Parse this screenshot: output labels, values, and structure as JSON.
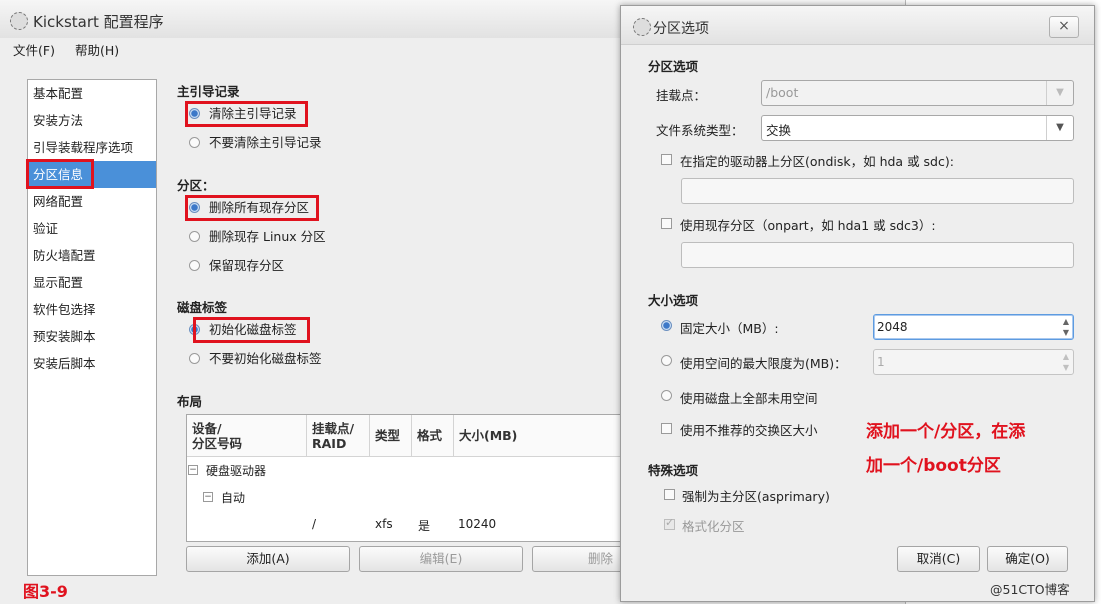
{
  "main": {
    "title": "Kickstart 配置程序",
    "menu": [
      "文件(F)",
      "帮助(H)"
    ],
    "sidebar": {
      "items": [
        "基本配置",
        "安装方法",
        "引导装载程序选项",
        "分区信息",
        "网络配置",
        "验证",
        "防火墙配置",
        "显示配置",
        "软件包选择",
        "预安装脚本",
        "安装后脚本"
      ],
      "selected": "分区信息"
    },
    "mbr": {
      "title": "主引导记录",
      "options": [
        "清除主引导记录",
        "不要清除主引导记录"
      ],
      "selected": "清除主引导记录"
    },
    "partitions": {
      "title": "分区：",
      "options": [
        "删除所有现存分区",
        "删除现存 Linux 分区",
        "保留现存分区"
      ],
      "selected": "删除所有现存分区"
    },
    "disklabel": {
      "title": "磁盘标签",
      "options": [
        "初始化磁盘标签",
        "不要初始化磁盘标签"
      ],
      "selected": "初始化磁盘标签"
    },
    "layout": {
      "title": "布局",
      "columns": [
        "设备/\n分区号码",
        "挂载点/\nRAID",
        "类型",
        "格式",
        "大小(MB)"
      ],
      "tree": {
        "root": "硬盘驱动器",
        "child": "自动",
        "row": {
          "mount": "/",
          "type": "xfs",
          "format": "是",
          "size": "10240"
        }
      }
    },
    "buttons": {
      "add": "添加(A)",
      "edit": "编辑(E)",
      "delete": "删除"
    },
    "figure_label": "图3-9"
  },
  "dialog": {
    "title": "分区选项",
    "close_icon": "×",
    "section_partition": "分区选项",
    "mount_label": "挂载点：",
    "mount_value": "/boot",
    "fs_label": "文件系统类型：",
    "fs_value": "交换",
    "ondisk_label": "在指定的驱动器上分区(ondisk，如 hda 或 sdc):",
    "onpart_label": "使用现存分区（onpart，如 hda1 或 sdc3）:",
    "section_size": "大小选项",
    "fixed_label": "固定大小（MB）:",
    "fixed_value": "2048",
    "max_label": "使用空间的最大限度为(MB)：",
    "max_value": "1",
    "fill_label": "使用磁盘上全部未用空间",
    "recommended_label": "使用不推荐的交换区大小",
    "size_selected": "固定大小（MB）:",
    "section_special": "特殊选项",
    "primary_label": "强制为主分区(asprimary)",
    "format_label": "格式化分区",
    "format_checked": true,
    "cancel": "取消(C)",
    "ok": "确定(O)"
  },
  "annotation": {
    "line1": "添加一个/分区，在添",
    "line2": "加一个/boot分区"
  },
  "watermark": "@51CTO博客",
  "colors": {
    "highlight_red": "#e0121e",
    "selection_blue": "#4a90d9"
  }
}
